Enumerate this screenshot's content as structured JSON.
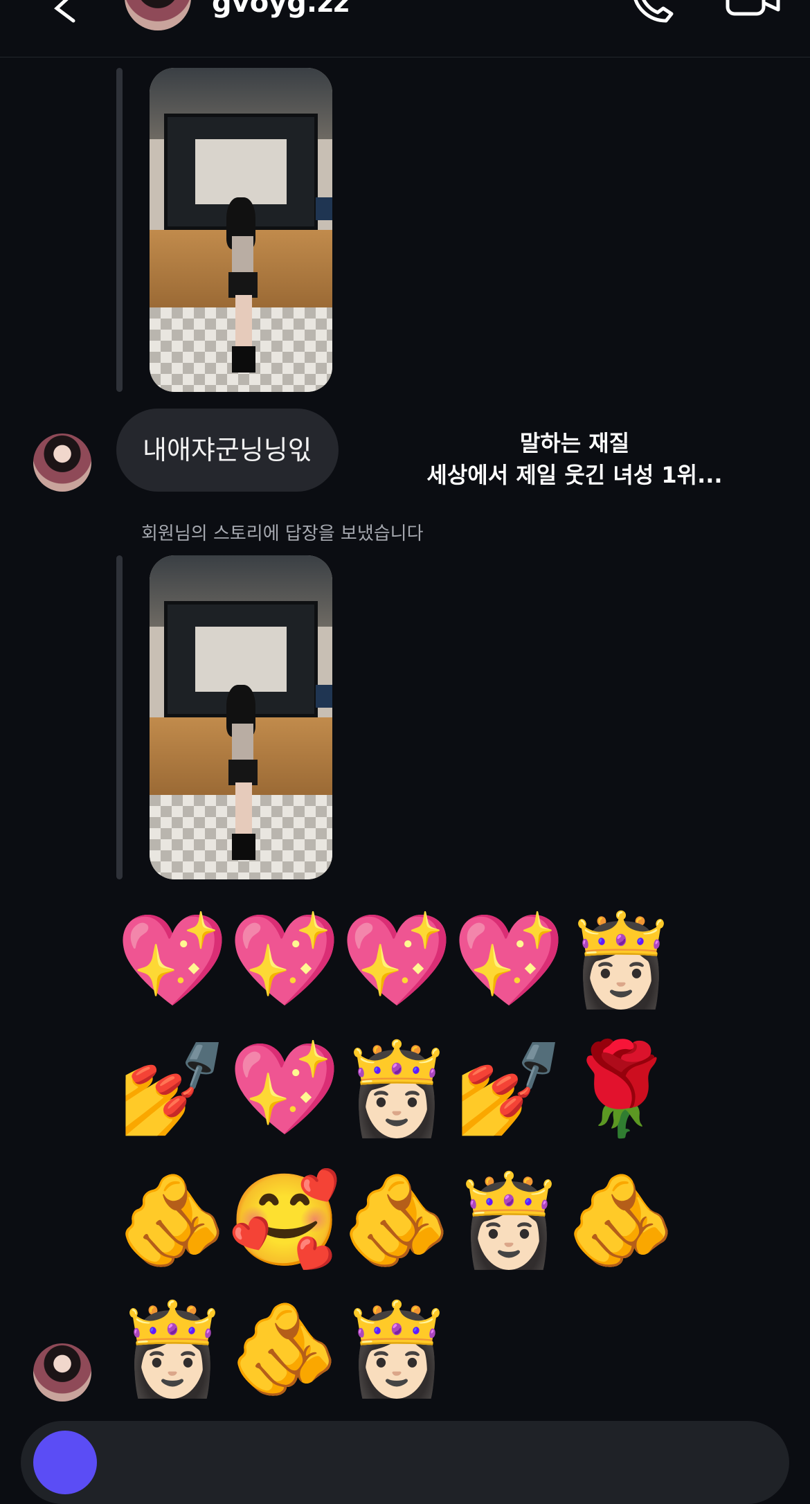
{
  "header": {
    "username": "gvoyg.zz",
    "icons": [
      "back-icon",
      "avatar",
      "call-icon",
      "video-call-icon"
    ]
  },
  "messages": {
    "story_reply_image_1": "story-photo",
    "text_bubble": "내애쟈군닝닝읷",
    "story_overlay_line1": "말하는 재질",
    "story_overlay_line2": "세상에서 제일 웃긴 녀성 1위...",
    "status_text": "회원님의 스토리에 답장을 보냈습니다",
    "story_reply_image_2": "story-photo",
    "emoji_rows": [
      [
        "💖",
        "💖",
        "💖",
        "💖",
        "👸🏻"
      ],
      [
        "💅",
        "💖",
        "👸🏻",
        "💅",
        "🌹"
      ],
      [
        "🫵",
        "🥰",
        "🫵",
        "👸🏻",
        "🫵"
      ],
      [
        "👸🏻",
        "🫵",
        "👸🏻"
      ]
    ]
  },
  "composer": {
    "camera_color": "#5b4df5"
  },
  "colors": {
    "background": "#0b0d12",
    "bubble": "#25272d",
    "status_text": "#a6a9b0"
  }
}
